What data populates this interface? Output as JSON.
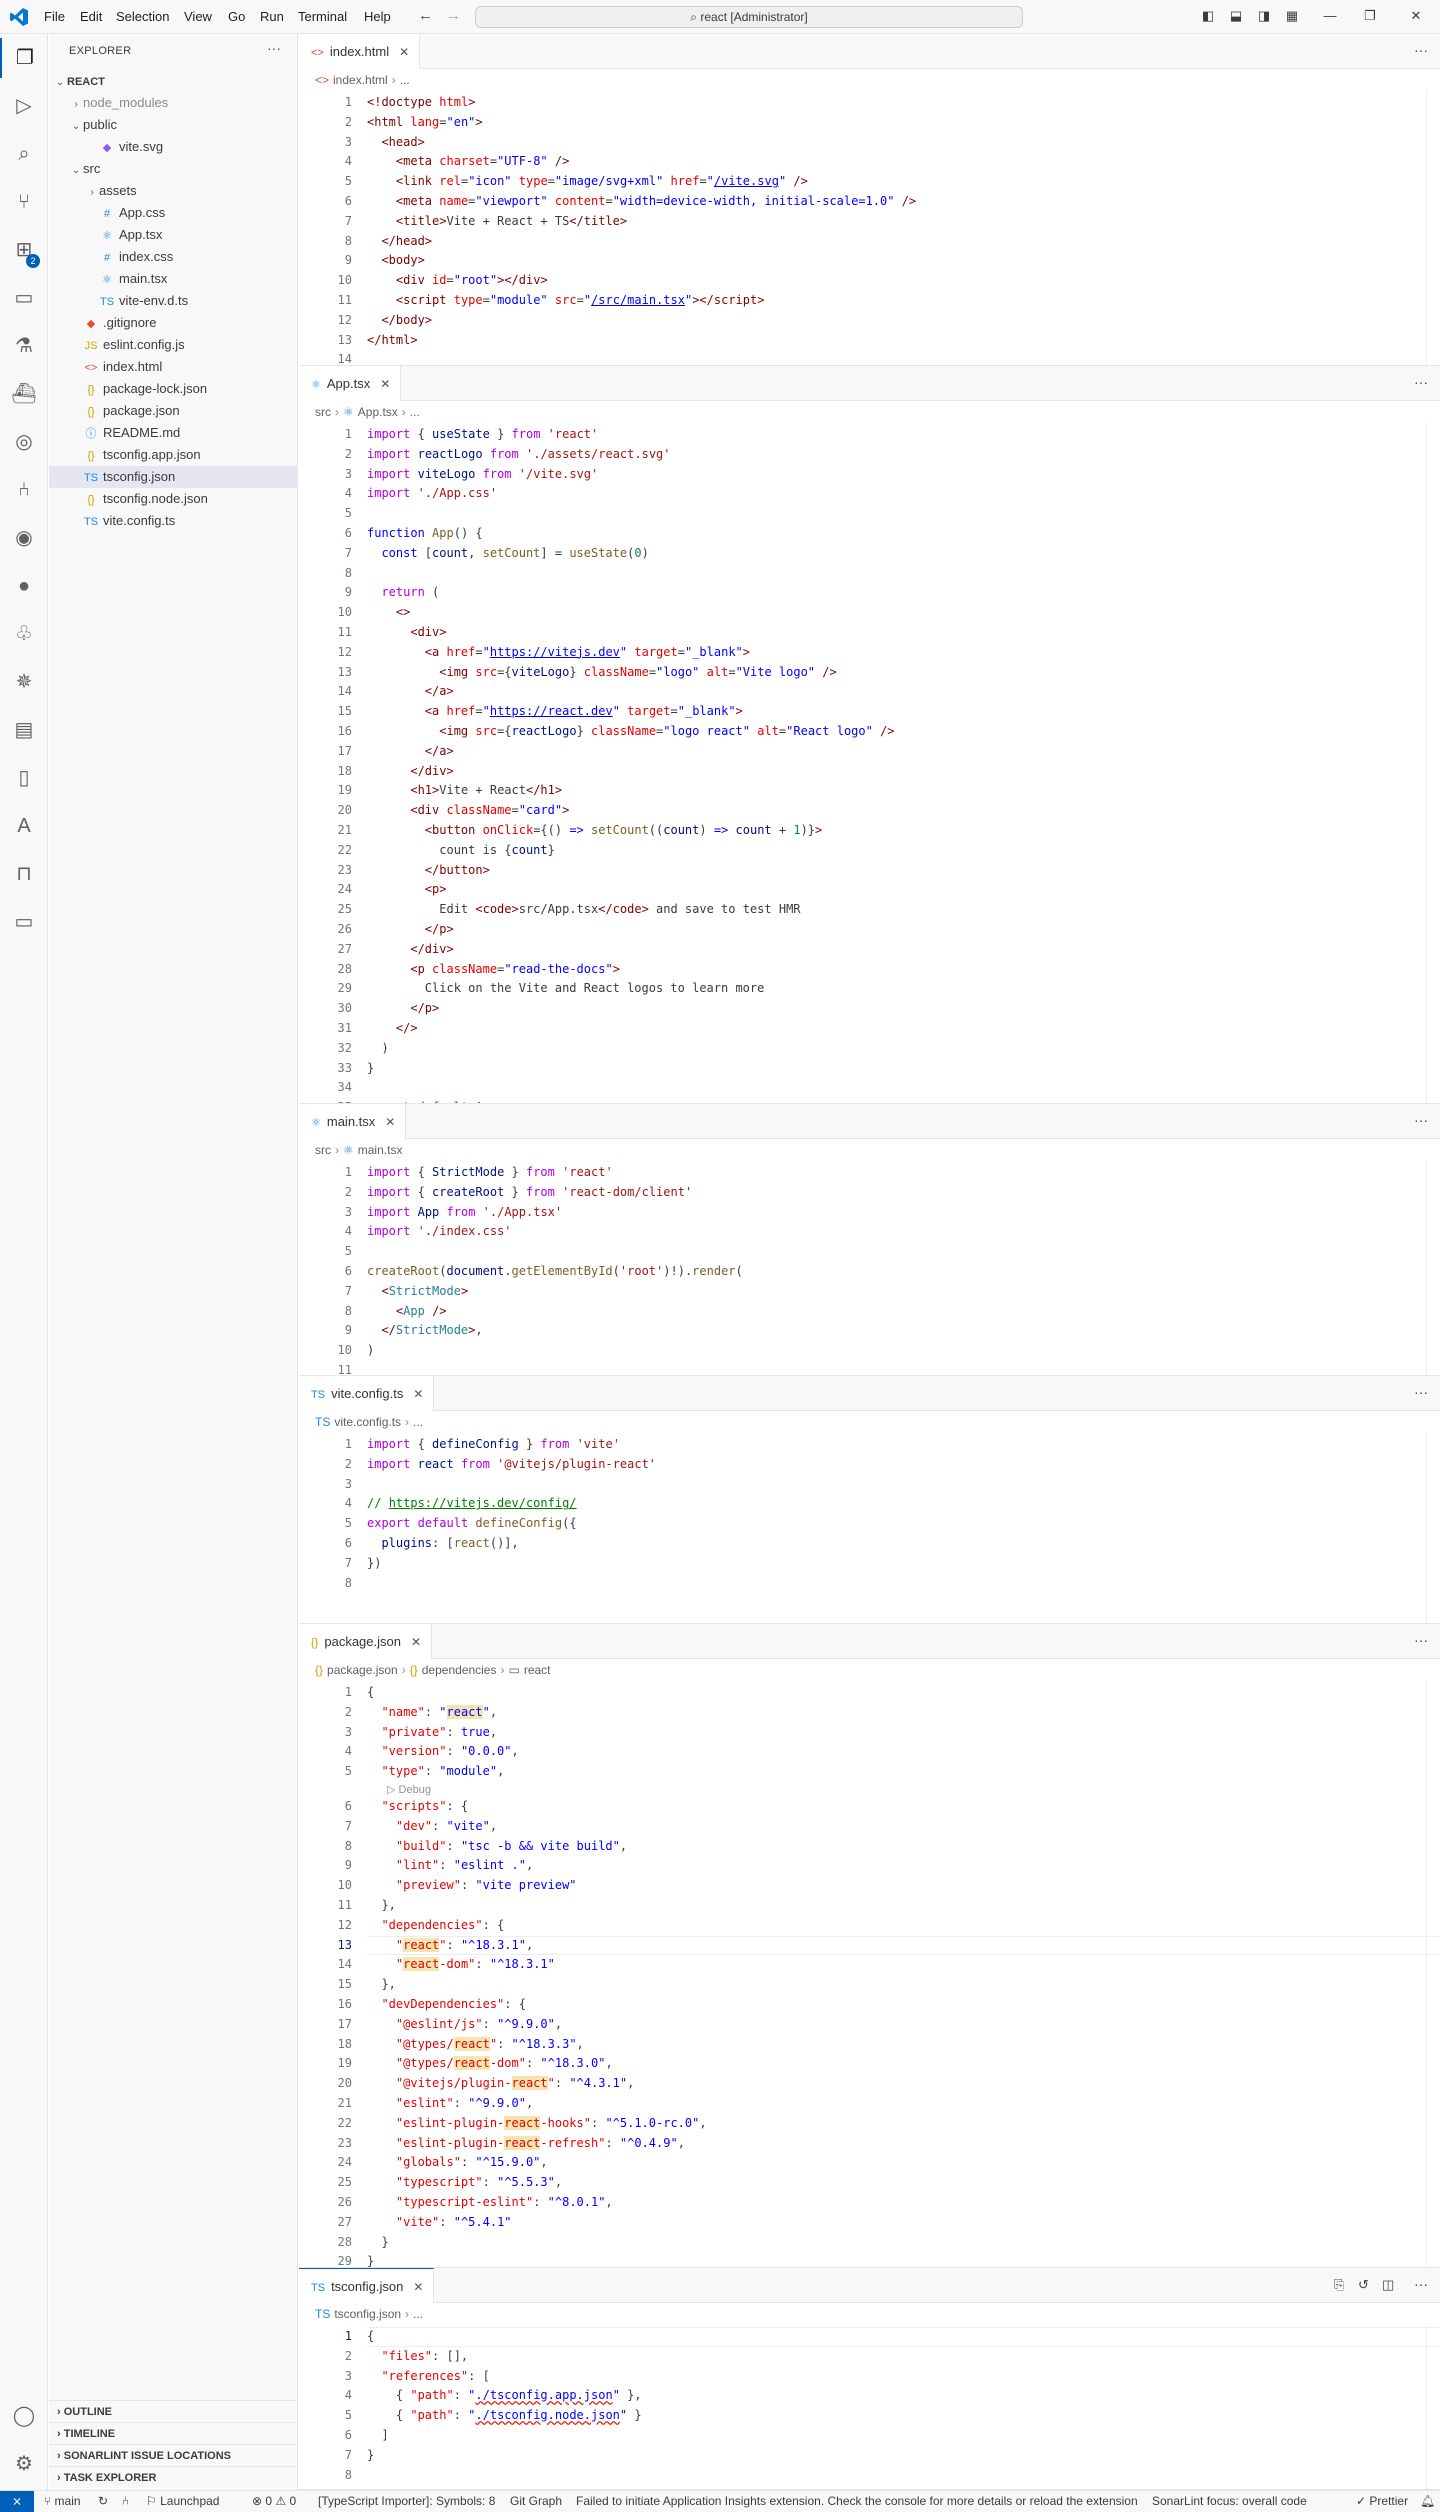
{
  "titlebar": {
    "menus": [
      "File",
      "Edit",
      "Selection",
      "View",
      "Go",
      "Run",
      "Terminal",
      "Help"
    ],
    "search": "react [Administrator]",
    "icons": [
      "back-arrow-icon",
      "forward-arrow-icon",
      "layout-sidebar-left-icon",
      "layout-panel-icon",
      "layout-sidebar-right-icon",
      "customize-layout-icon",
      "minimize-icon",
      "maximize-icon",
      "close-icon"
    ]
  },
  "activitybar": {
    "icons": [
      "explorer-icon",
      "run-debug-icon",
      "search-icon",
      "source-control-icon",
      "extensions-icon",
      "remote-explorer-icon",
      "testing-icon",
      "docker-icon",
      "timeline-icon",
      "git-graph-icon",
      "github-icon",
      "gitlens-icon",
      "kubernetes-icon",
      "containers-icon",
      "bookmarks-icon",
      "azure-icon",
      "bookmark-icon",
      "feedback-icon"
    ],
    "extensions_badge": "2",
    "bottom_icons": [
      "account-icon",
      "manage-gear-icon"
    ]
  },
  "sidebar": {
    "title": "EXPLORER",
    "tree": [
      {
        "label": "REACT",
        "indent": 0,
        "chev": "⌄",
        "icon": "",
        "iconColor": "",
        "root": true
      },
      {
        "label": "node_modules",
        "indent": 1,
        "chev": "›",
        "icon": "",
        "iconColor": "",
        "dim": true
      },
      {
        "label": "public",
        "indent": 1,
        "chev": "⌄",
        "icon": "",
        "iconColor": ""
      },
      {
        "label": "vite.svg",
        "indent": 2,
        "chev": "",
        "icon": "◆",
        "iconColor": "#8a5cf5"
      },
      {
        "label": "src",
        "indent": 1,
        "chev": "⌄",
        "icon": "",
        "iconColor": ""
      },
      {
        "label": "assets",
        "indent": 2,
        "chev": "›",
        "icon": "",
        "iconColor": ""
      },
      {
        "label": "App.css",
        "indent": 2,
        "chev": "",
        "icon": "#",
        "iconColor": "#1e88e5"
      },
      {
        "label": "App.tsx",
        "indent": 2,
        "chev": "",
        "icon": "⚛",
        "iconColor": "#1e88e5"
      },
      {
        "label": "index.css",
        "indent": 2,
        "chev": "",
        "icon": "#",
        "iconColor": "#1e88e5"
      },
      {
        "label": "main.tsx",
        "indent": 2,
        "chev": "",
        "icon": "⚛",
        "iconColor": "#1e88e5"
      },
      {
        "label": "vite-env.d.ts",
        "indent": 2,
        "chev": "",
        "icon": "TS",
        "iconColor": "#1e88e5"
      },
      {
        "label": ".gitignore",
        "indent": 1,
        "chev": "",
        "icon": "◆",
        "iconColor": "#e44d26"
      },
      {
        "label": "eslint.config.js",
        "indent": 1,
        "chev": "",
        "icon": "JS",
        "iconColor": "#c7b000"
      },
      {
        "label": "index.html",
        "indent": 1,
        "chev": "",
        "icon": "<>",
        "iconColor": "#e44d26"
      },
      {
        "label": "package-lock.json",
        "indent": 1,
        "chev": "",
        "icon": "{}",
        "iconColor": "#c7a000"
      },
      {
        "label": "package.json",
        "indent": 1,
        "chev": "",
        "icon": "{}",
        "iconColor": "#c7a000"
      },
      {
        "label": "README.md",
        "indent": 1,
        "chev": "",
        "icon": "ⓘ",
        "iconColor": "#1e88e5"
      },
      {
        "label": "tsconfig.app.json",
        "indent": 1,
        "chev": "",
        "icon": "{}",
        "iconColor": "#c7a000"
      },
      {
        "label": "tsconfig.json",
        "indent": 1,
        "chev": "",
        "icon": "TS",
        "iconColor": "#1e88e5",
        "selected": true
      },
      {
        "label": "tsconfig.node.json",
        "indent": 1,
        "chev": "",
        "icon": "{}",
        "iconColor": "#c7a000"
      },
      {
        "label": "vite.config.ts",
        "indent": 1,
        "chev": "",
        "icon": "TS",
        "iconColor": "#1e88e5"
      }
    ],
    "bottom_sections": [
      "OUTLINE",
      "TIMELINE",
      "SONARLINT ISSUE LOCATIONS",
      "TASK EXPLORER"
    ]
  },
  "editors": [
    {
      "id": "g1",
      "tab": "index.html",
      "tabIcon": "<>",
      "tabIconColor": "#e44d26",
      "active": false,
      "crumbs": [
        {
          "icon": "<>",
          "iconColor": "#e44d26",
          "text": "index.html"
        },
        {
          "text": "..."
        }
      ],
      "lines": [
        [
          "<span class='t'>&lt;!doctype</span> <span class='a'>html</span><span class='t'>&gt;</span>"
        ],
        [
          "<span class='t'>&lt;html</span> <span class='a'>lang</span>=<span class='kb'>\"en\"</span><span class='t'>&gt;</span>"
        ],
        [
          "  <span class='t'>&lt;head&gt;</span>"
        ],
        [
          "    <span class='t'>&lt;meta</span> <span class='a'>charset</span>=<span class='kb'>\"UTF-8\"</span> <span class='t'>/&gt;</span>"
        ],
        [
          "    <span class='t'>&lt;link</span> <span class='a'>rel</span>=<span class='kb'>\"icon\"</span> <span class='a'>type</span>=<span class='kb'>\"image/svg+xml\"</span> <span class='a'>href</span>=<span class='kb'>\"</span><span class='u'>/vite.svg</span><span class='kb'>\"</span> <span class='t'>/&gt;</span>"
        ],
        [
          "    <span class='t'>&lt;meta</span> <span class='a'>name</span>=<span class='kb'>\"viewport\"</span> <span class='a'>content</span>=<span class='kb'>\"width=device-width, initial-scale=1.0\"</span> <span class='t'>/&gt;</span>"
        ],
        [
          "    <span class='t'>&lt;title&gt;</span>Vite + React + TS<span class='t'>&lt;/title&gt;</span>"
        ],
        [
          "  <span class='t'>&lt;/head&gt;</span>"
        ],
        [
          "  <span class='t'>&lt;body&gt;</span>"
        ],
        [
          "    <span class='t'>&lt;div</span> <span class='a'>id</span>=<span class='kb'>\"root\"</span><span class='t'>&gt;&lt;/div&gt;</span>"
        ],
        [
          "    <span class='t'>&lt;script</span> <span class='a'>type</span>=<span class='kb'>\"module\"</span> <span class='a'>src</span>=<span class='kb'>\"</span><span class='u'>/src/main.tsx</span><span class='kb'>\"</span><span class='t'>&gt;&lt;/script&gt;</span>"
        ],
        [
          "  <span class='t'>&lt;/body&gt;</span>"
        ],
        [
          "<span class='t'>&lt;/html&gt;</span>"
        ],
        [
          ""
        ]
      ]
    },
    {
      "id": "g2",
      "tab": "App.tsx",
      "tabIcon": "⚛",
      "tabIconColor": "#1e88e5",
      "active": false,
      "crumbs": [
        {
          "text": "src"
        },
        {
          "icon": "⚛",
          "iconColor": "#1e88e5",
          "text": "App.tsx"
        },
        {
          "text": "..."
        }
      ],
      "lines": [
        [
          "<span class='k'>import</span> { <span class='v'>useState</span> } <span class='k'>from</span> <span class='s'>'react'</span>"
        ],
        [
          "<span class='k'>import</span> <span class='v'>reactLogo</span> <span class='k'>from</span> <span class='s'>'./assets/react.svg'</span>"
        ],
        [
          "<span class='k'>import</span> <span class='v'>viteLogo</span> <span class='k'>from</span> <span class='s'>'/vite.svg'</span>"
        ],
        [
          "<span class='k'>import</span> <span class='s'>'./App.css'</span>"
        ],
        [
          ""
        ],
        [
          "<span class='kb'>function</span> <span class='f'>App</span>() {"
        ],
        [
          "  <span class='kb'>const</span> [<span class='v'>count</span>, <span class='f'>setCount</span>] = <span class='f'>useState</span>(<span class='n'>0</span>)"
        ],
        [
          ""
        ],
        [
          "  <span class='k'>return</span> ("
        ],
        [
          "    <span class='t'>&lt;&gt;</span>"
        ],
        [
          "      <span class='t'>&lt;div&gt;</span>"
        ],
        [
          "        <span class='t'>&lt;a</span> <span class='a'>href</span>=<span class='kb'>\"</span><span class='u'>https://vitejs.dev</span><span class='kb'>\"</span> <span class='a'>target</span>=<span class='kb'>\"_blank\"</span><span class='t'>&gt;</span>"
        ],
        [
          "          <span class='t'>&lt;img</span> <span class='a'>src</span>={<span class='v'>viteLogo</span>} <span class='a'>className</span>=<span class='kb'>\"logo\"</span> <span class='a'>alt</span>=<span class='kb'>\"Vite logo\"</span> <span class='t'>/&gt;</span>"
        ],
        [
          "        <span class='t'>&lt;/a&gt;</span>"
        ],
        [
          "        <span class='t'>&lt;a</span> <span class='a'>href</span>=<span class='kb'>\"</span><span class='u'>https://react.dev</span><span class='kb'>\"</span> <span class='a'>target</span>=<span class='kb'>\"_blank\"</span><span class='t'>&gt;</span>"
        ],
        [
          "          <span class='t'>&lt;img</span> <span class='a'>src</span>={<span class='v'>reactLogo</span>} <span class='a'>className</span>=<span class='kb'>\"logo react\"</span> <span class='a'>alt</span>=<span class='kb'>\"React logo\"</span> <span class='t'>/&gt;</span>"
        ],
        [
          "        <span class='t'>&lt;/a&gt;</span>"
        ],
        [
          "      <span class='t'>&lt;/div&gt;</span>"
        ],
        [
          "      <span class='t'>&lt;h1&gt;</span>Vite + React<span class='t'>&lt;/h1&gt;</span>"
        ],
        [
          "      <span class='t'>&lt;div</span> <span class='a'>className</span>=<span class='kb'>\"card\"</span><span class='t'>&gt;</span>"
        ],
        [
          "        <span class='t'>&lt;button</span> <span class='a'>onClick</span>={() <span class='kb'>=&gt;</span> <span class='f'>setCount</span>((<span class='v'>count</span>) <span class='kb'>=&gt;</span> <span class='v'>count</span> + <span class='n'>1</span>)}<span class='t'>&gt;</span>"
        ],
        [
          "          count is {<span class='v'>count</span>}"
        ],
        [
          "        <span class='t'>&lt;/button&gt;</span>"
        ],
        [
          "        <span class='t'>&lt;p&gt;</span>"
        ],
        [
          "          Edit <span class='t'>&lt;code&gt;</span>src/App.tsx<span class='t'>&lt;/code&gt;</span> and save to test HMR"
        ],
        [
          "        <span class='t'>&lt;/p&gt;</span>"
        ],
        [
          "      <span class='t'>&lt;/div&gt;</span>"
        ],
        [
          "      <span class='t'>&lt;p</span> <span class='a'>className</span>=<span class='kb'>\"read-the-docs\"</span><span class='t'>&gt;</span>"
        ],
        [
          "        Click on the Vite and React logos to learn more"
        ],
        [
          "      <span class='t'>&lt;/p&gt;</span>"
        ],
        [
          "    <span class='t'>&lt;/&gt;</span>"
        ],
        [
          "  )"
        ],
        [
          "}"
        ],
        [
          ""
        ],
        [
          "<span class='k'>export</span> <span class='k'>default</span> <span class='f'>App</span>"
        ],
        [
          ""
        ]
      ]
    },
    {
      "id": "g3",
      "tab": "main.tsx",
      "tabIcon": "⚛",
      "tabIconColor": "#1e88e5",
      "active": false,
      "crumbs": [
        {
          "text": "src"
        },
        {
          "icon": "⚛",
          "iconColor": "#1e88e5",
          "text": "main.tsx"
        }
      ],
      "lines": [
        [
          "<span class='k'>import</span> { <span class='v'>StrictMode</span> } <span class='k'>from</span> <span class='s'>'react'</span>"
        ],
        [
          "<span class='k'>import</span> { <span class='v'>createRoot</span> } <span class='k'>from</span> <span class='s'>'react-dom/client'</span>"
        ],
        [
          "<span class='k'>import</span> <span class='v'>App</span> <span class='k'>from</span> <span class='s'>'./App.tsx'</span>"
        ],
        [
          "<span class='k'>import</span> <span class='s'>'./index.css'</span>"
        ],
        [
          ""
        ],
        [
          "<span class='f'>createRoot</span>(<span class='v'>document</span>.<span class='f'>getElementById</span>(<span class='s'>'root'</span>)!).<span class='f'>render</span>("
        ],
        [
          "  <span class='t'>&lt;</span><span class='ty'>StrictMode</span><span class='t'>&gt;</span>"
        ],
        [
          "    <span class='t'>&lt;</span><span class='ty'>App</span> <span class='t'>/&gt;</span>"
        ],
        [
          "  <span class='t'>&lt;/</span><span class='ty'>StrictMode</span><span class='t'>&gt;</span>,"
        ],
        [
          ")"
        ],
        [
          ""
        ]
      ]
    },
    {
      "id": "g4",
      "tab": "vite.config.ts",
      "tabIcon": "TS",
      "tabIconColor": "#1e88e5",
      "active": false,
      "crumbs": [
        {
          "icon": "TS",
          "iconColor": "#1e88e5",
          "text": "vite.config.ts"
        },
        {
          "text": "..."
        }
      ],
      "lines": [
        [
          "<span class='k'>import</span> { <span class='v'>defineConfig</span> } <span class='k'>from</span> <span class='s'>'vite'</span>"
        ],
        [
          "<span class='k'>import</span> <span class='v'>react</span> <span class='k'>from</span> <span class='s'>'@vitejs/plugin-react'</span>"
        ],
        [
          ""
        ],
        [
          "<span class='c'>// </span><span class='c' style='text-decoration:underline'>https://vitejs.dev/config/</span>"
        ],
        [
          "<span class='k'>export</span> <span class='k'>default</span> <span class='f'>defineConfig</span>({"
        ],
        [
          "  <span class='v'>plugins</span>: [<span class='f'>react</span>()],"
        ],
        [
          "})"
        ],
        [
          ""
        ]
      ]
    },
    {
      "id": "g5",
      "tab": "package.json",
      "tabIcon": "{}",
      "tabIconColor": "#c7a000",
      "active": false,
      "crumbs": [
        {
          "icon": "{}",
          "iconColor": "#c7a000",
          "text": "package.json"
        },
        {
          "icon": "{}",
          "iconColor": "#c7a000",
          "text": "dependencies"
        },
        {
          "icon": "▭",
          "iconColor": "#616161",
          "text": "react"
        }
      ],
      "codelens": {
        "after": 5,
        "text": "▷ Debug"
      },
      "current": 13,
      "lines": [
        [
          "{"
        ],
        [
          "  <span class='a'>\"name\"</span>: <span class='kb'>\"<span class='hl'>react</span>\"</span>,"
        ],
        [
          "  <span class='a'>\"private\"</span>: <span class='kb'>true</span>,"
        ],
        [
          "  <span class='a'>\"version\"</span>: <span class='kb'>\"0.0.0\"</span>,"
        ],
        [
          "  <span class='a'>\"type\"</span>: <span class='kb'>\"module\"</span>,"
        ],
        [
          "  <span class='a'>\"scripts\"</span>: {"
        ],
        [
          "    <span class='a'>\"dev\"</span>: <span class='kb'>\"vite\"</span>,"
        ],
        [
          "    <span class='a'>\"build\"</span>: <span class='kb'>\"tsc -b &amp;&amp; vite build\"</span>,"
        ],
        [
          "    <span class='a'>\"lint\"</span>: <span class='kb'>\"eslint .\"</span>,"
        ],
        [
          "    <span class='a'>\"preview\"</span>: <span class='kb'>\"vite preview\"</span>"
        ],
        [
          "  },"
        ],
        [
          "  <span class='a'>\"dependencies\"</span>: {"
        ],
        [
          "    <span class='a'>\"<span class='hl'>react</span>\"</span>: <span class='kb'>\"^18.3.1\"</span>,"
        ],
        [
          "    <span class='a'>\"<span class='hl'>react</span>-dom\"</span>: <span class='kb'>\"^18.3.1\"</span>"
        ],
        [
          "  },"
        ],
        [
          "  <span class='a'>\"devDependencies\"</span>: {"
        ],
        [
          "    <span class='a'>\"@eslint/js\"</span>: <span class='kb'>\"^9.9.0\"</span>,"
        ],
        [
          "    <span class='a'>\"@types/<span class='hl'>react</span>\"</span>: <span class='kb'>\"^18.3.3\"</span>,"
        ],
        [
          "    <span class='a'>\"@types/<span class='hl'>react</span>-dom\"</span>: <span class='kb'>\"^18.3.0\"</span>,"
        ],
        [
          "    <span class='a'>\"@vitejs/plugin-<span class='hl'>react</span>\"</span>: <span class='kb'>\"^4.3.1\"</span>,"
        ],
        [
          "    <span class='a'>\"eslint\"</span>: <span class='kb'>\"^9.9.0\"</span>,"
        ],
        [
          "    <span class='a'>\"eslint-plugin-<span class='hl'>react</span>-hooks\"</span>: <span class='kb'>\"^5.1.0-rc.0\"</span>,"
        ],
        [
          "    <span class='a'>\"eslint-plugin-<span class='hl'>react</span>-refresh\"</span>: <span class='kb'>\"^0.4.9\"</span>,"
        ],
        [
          "    <span class='a'>\"globals\"</span>: <span class='kb'>\"^15.9.0\"</span>,"
        ],
        [
          "    <span class='a'>\"typescript\"</span>: <span class='kb'>\"^5.5.3\"</span>,"
        ],
        [
          "    <span class='a'>\"typescript-eslint\"</span>: <span class='kb'>\"^8.0.1\"</span>,"
        ],
        [
          "    <span class='a'>\"vite\"</span>: <span class='kb'>\"^5.4.1\"</span>"
        ],
        [
          "  }"
        ],
        [
          "}"
        ],
        [
          ""
        ]
      ]
    },
    {
      "id": "g6",
      "tab": "tsconfig.json",
      "tabIcon": "TS",
      "tabIconColor": "#1e88e5",
      "active": true,
      "crumbs": [
        {
          "icon": "TS",
          "iconColor": "#1e88e5",
          "text": "tsconfig.json"
        },
        {
          "text": "..."
        }
      ],
      "current": 1,
      "lines": [
        [
          "{"
        ],
        [
          "  <span class='a'>\"files\"</span>: [],"
        ],
        [
          "  <span class='a'>\"references\"</span>: ["
        ],
        [
          "    { <span class='a'>\"path\"</span>: <span class='kb'>\"<span class='err'>./tsconfig.app.json</span>\"</span> },"
        ],
        [
          "    { <span class='a'>\"path\"</span>: <span class='kb'>\"<span class='err'>./tsconfig.node.json</span>\"</span> }"
        ],
        [
          "  ]"
        ],
        [
          "}"
        ],
        [
          ""
        ]
      ]
    }
  ],
  "statusbar": {
    "branch": "main",
    "sync": "↻",
    "launchpad": "Launchpad",
    "problems": "⊗ 0 ⚠ 0",
    "importer": "[TypeScript Importer]: Symbols: 8",
    "gitgraph": "Git Graph",
    "message": "Failed to initiate Application Insights extension. Check the console for more details or reload the extension",
    "sonarlint": "SonarLint focus: overall code",
    "prettier": "✓ Prettier"
  }
}
